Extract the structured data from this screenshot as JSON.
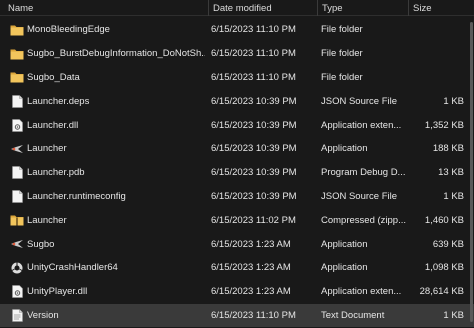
{
  "columns": {
    "name": "Name",
    "date": "Date modified",
    "type": "Type",
    "size": "Size"
  },
  "files": [
    {
      "name": "MonoBleedingEdge",
      "date": "6/15/2023 11:10 PM",
      "type": "File folder",
      "size": "",
      "icon": "folder-icon"
    },
    {
      "name": "Sugbo_BurstDebugInformation_DoNotSh...",
      "date": "6/15/2023 11:10 PM",
      "type": "File folder",
      "size": "",
      "icon": "folder-icon"
    },
    {
      "name": "Sugbo_Data",
      "date": "6/15/2023 11:10 PM",
      "type": "File folder",
      "size": "",
      "icon": "folder-icon"
    },
    {
      "name": "Launcher.deps",
      "date": "6/15/2023 10:39 PM",
      "type": "JSON Source File",
      "size": "1 KB",
      "icon": "document-icon"
    },
    {
      "name": "Launcher.dll",
      "date": "6/15/2023 10:39 PM",
      "type": "Application exten...",
      "size": "1,352 KB",
      "icon": "dll-icon"
    },
    {
      "name": "Launcher",
      "date": "6/15/2023 10:39 PM",
      "type": "Application",
      "size": "188 KB",
      "icon": "app-icon"
    },
    {
      "name": "Launcher.pdb",
      "date": "6/15/2023 10:39 PM",
      "type": "Program Debug D...",
      "size": "13 KB",
      "icon": "document-icon"
    },
    {
      "name": "Launcher.runtimeconfig",
      "date": "6/15/2023 10:39 PM",
      "type": "JSON Source File",
      "size": "1 KB",
      "icon": "document-icon"
    },
    {
      "name": "Launcher",
      "date": "6/15/2023 11:02 PM",
      "type": "Compressed (zipp...",
      "size": "1,460 KB",
      "icon": "zip-folder-icon"
    },
    {
      "name": "Sugbo",
      "date": "6/15/2023 1:23 AM",
      "type": "Application",
      "size": "639 KB",
      "icon": "app-icon"
    },
    {
      "name": "UnityCrashHandler64",
      "date": "6/15/2023 1:23 AM",
      "type": "Application",
      "size": "1,098 KB",
      "icon": "unity-icon"
    },
    {
      "name": "UnityPlayer.dll",
      "date": "6/15/2023 1:23 AM",
      "type": "Application exten...",
      "size": "28,614 KB",
      "icon": "dll-icon"
    },
    {
      "name": "Version",
      "date": "6/15/2023 11:10 PM",
      "type": "Text Document",
      "size": "1 KB",
      "icon": "text-file-icon",
      "selected": true
    }
  ],
  "colors": {
    "background": "#191919",
    "selected_row": "#3a3a3a",
    "folder": "#f2c55c",
    "text": "#e6e6e6"
  }
}
